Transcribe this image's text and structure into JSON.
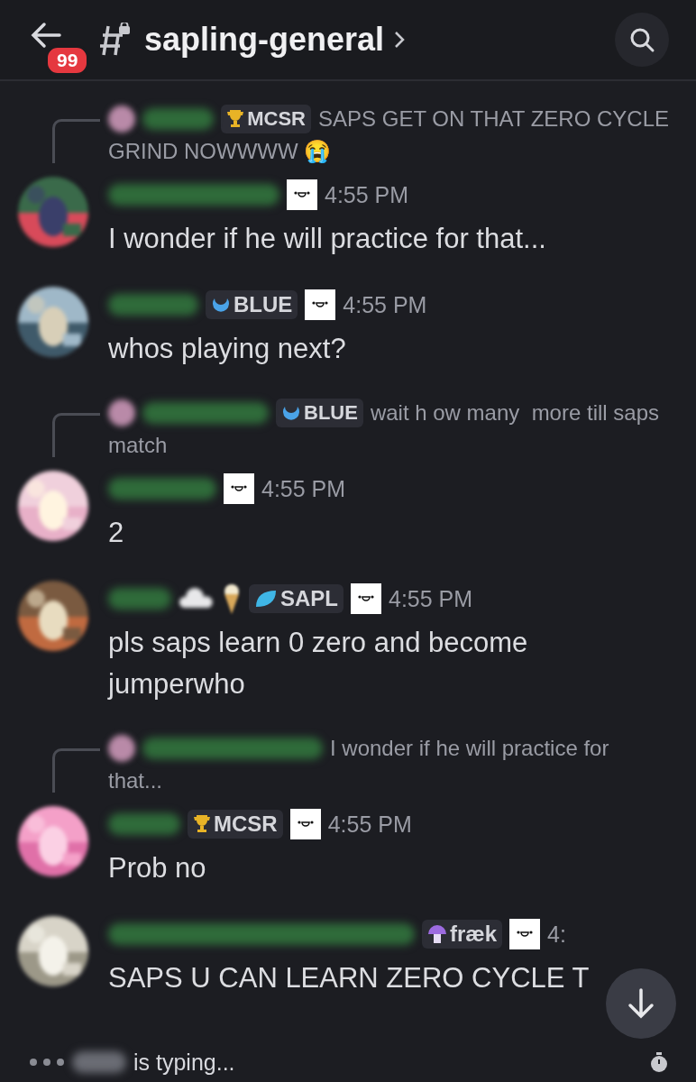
{
  "header": {
    "back_badge": "99",
    "channel": "sapling-general"
  },
  "messages": [
    {
      "reply": {
        "tag": {
          "kind": "trophy",
          "label": "MCSR"
        },
        "lines": [
          "SAPS GET ON THAT ZERO CYCLE",
          "GRIND NOWWWW 😭"
        ]
      },
      "time": "4:55 PM",
      "text": "I wonder if he will practice for that..."
    },
    {
      "tag": {
        "kind": "crescent",
        "label": "BLUE"
      },
      "time": "4:55 PM",
      "text": "whos playing next?"
    },
    {
      "reply": {
        "tag": {
          "kind": "crescent",
          "label": "BLUE"
        },
        "lines": [
          "wait h ow many  more till saps",
          "match"
        ]
      },
      "time": "4:55 PM",
      "text": "2"
    },
    {
      "name_emojis": [
        {
          "kind": "cloud"
        },
        {
          "kind": "ice_cream"
        }
      ],
      "tag": {
        "kind": "leaf",
        "label": "SAPL"
      },
      "time": "4:55 PM",
      "text": "pls saps learn 0 zero and become jumperwho"
    },
    {
      "reply": {
        "lines": [
          "I wonder if he will practice for",
          "that..."
        ]
      },
      "tag": {
        "kind": "trophy",
        "label": "MCSR"
      },
      "time": "4:55 PM",
      "text": "Prob no"
    },
    {
      "tag": {
        "kind": "mushroom",
        "label": "fræk"
      },
      "time": "4:",
      "text": "SAPS U CAN LEARN ZERO CYCLE T"
    }
  ],
  "typing": {
    "text": "is typing..."
  }
}
